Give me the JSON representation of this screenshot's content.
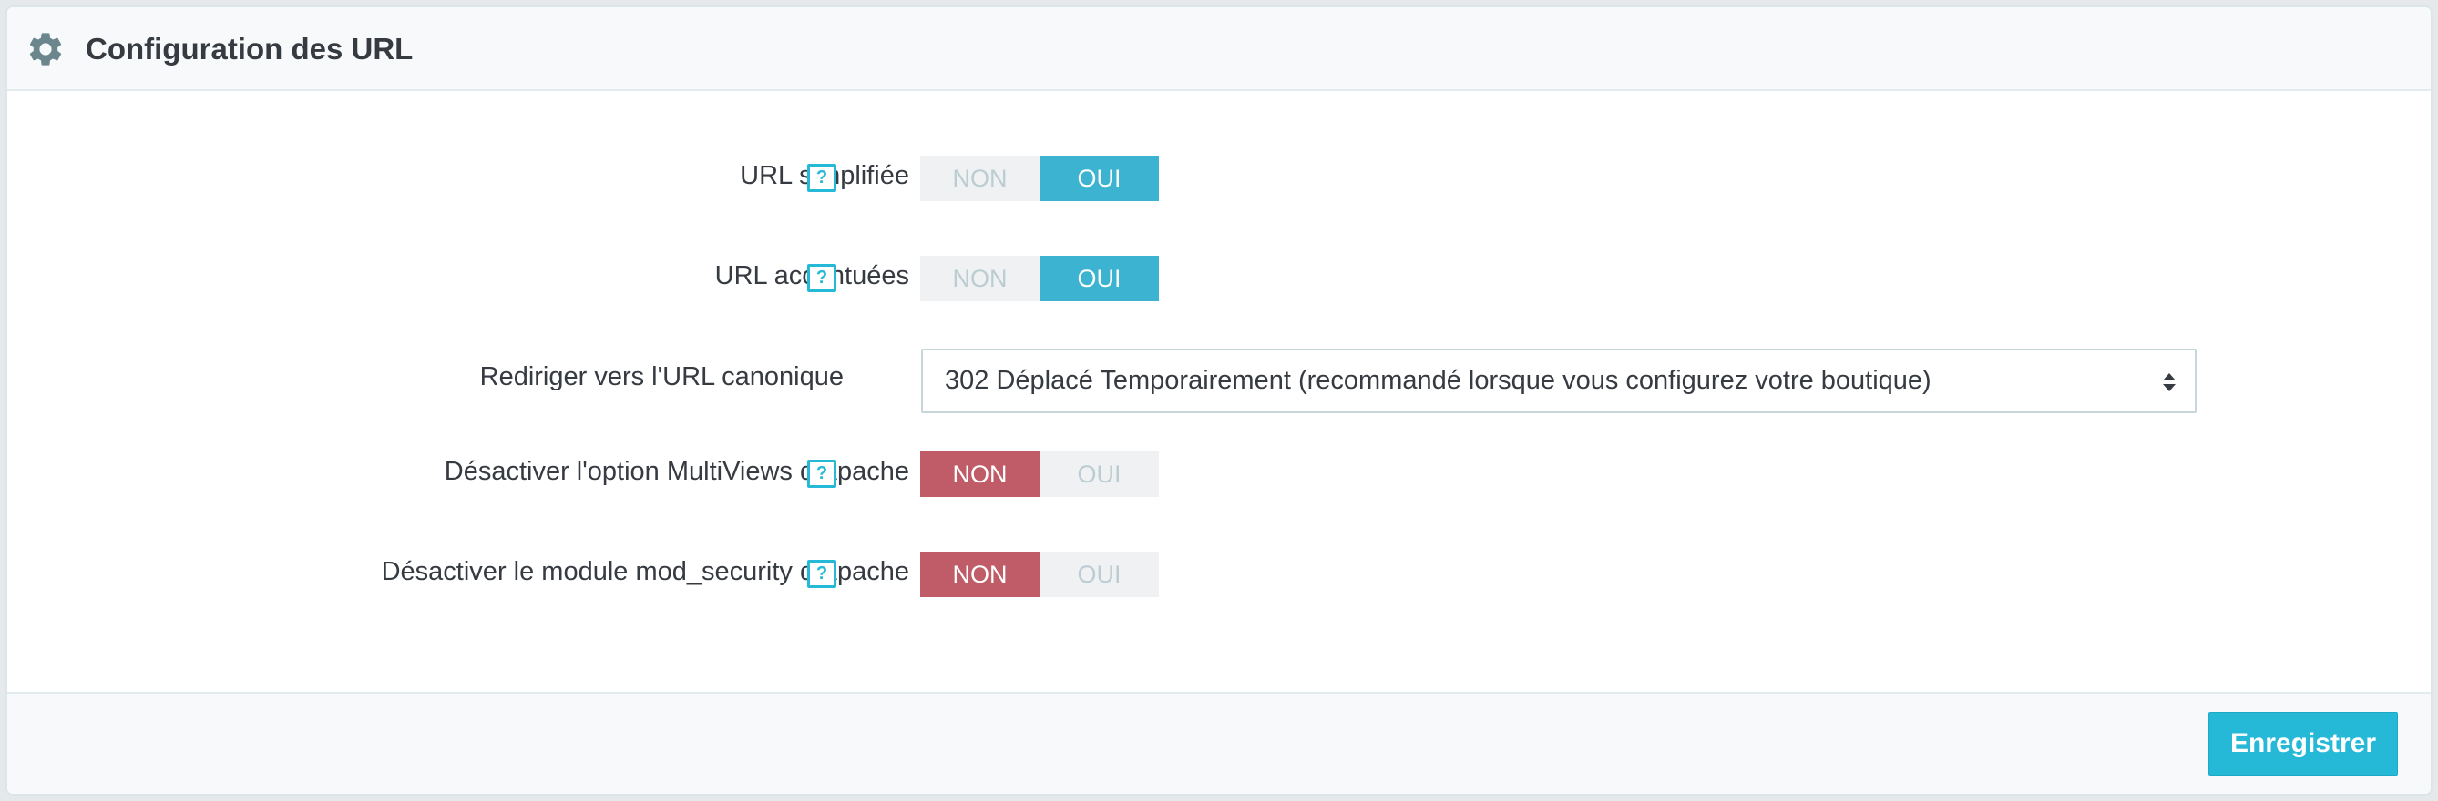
{
  "panel": {
    "title": "Configuration des URL",
    "icon": "gear-icon"
  },
  "fields": {
    "simplified_url": {
      "label": "URL simplifiée",
      "help": "?",
      "off_label": "NON",
      "on_label": "OUI",
      "value": "OUI"
    },
    "accented_url": {
      "label": "URL accentuées",
      "help": "?",
      "off_label": "NON",
      "on_label": "OUI",
      "value": "OUI"
    },
    "canonical_redirect": {
      "label": "Rediriger vers l'URL canonique",
      "selected": "302 Déplacé Temporairement (recommandé lorsque vous configurez votre boutique)"
    },
    "disable_multiviews": {
      "label": "Désactiver l'option MultiViews d'Apache",
      "help": "?",
      "off_label": "NON",
      "on_label": "OUI",
      "value": "NON"
    },
    "disable_mod_security": {
      "label": "Désactiver le module mod_security d'Apache",
      "help": "?",
      "off_label": "NON",
      "on_label": "OUI",
      "value": "NON"
    }
  },
  "footer": {
    "save_label": "Enregistrer"
  },
  "colors": {
    "accent": "#25b9d7",
    "switch_on": "#3bb3d1",
    "switch_off_active": "#c05c67",
    "switch_inactive": "#eff1f2"
  }
}
